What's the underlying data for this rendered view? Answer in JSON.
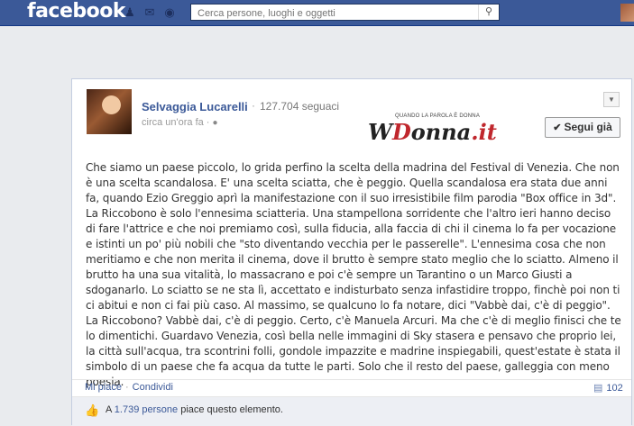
{
  "topbar": {
    "logo": "facebook",
    "search_placeholder": "Cerca persone, luoghi e oggetti",
    "icons": [
      "friend-requests-icon",
      "messages-icon",
      "notifications-icon",
      "search-icon"
    ]
  },
  "post": {
    "author": "Selvaggia Lucarelli",
    "separator": "·",
    "followers": "127.704 seguaci",
    "time": "circa un'ora fa ·",
    "brand_logo": {
      "text_prefix": "W",
      "text_d": "D",
      "text_rest": "onna",
      "text_suffix": ".it",
      "tagline": "QUANDO LA PAROLA È DONNA"
    },
    "follow_button": "Segui già",
    "body": "Che siamo un paese piccolo, lo grida perfino la scelta della madrina del Festival di Venezia. Che non è una scelta scandalosa. E' una scelta sciatta, che è peggio. Quella scandalosa era stata due anni fa, quando Ezio Greggio aprì la manifestazione con il suo irresistibile film parodia \"Box office in 3d\". La Riccobono è solo l'ennesima sciatteria. Una stampellona sorridente che l'altro ieri hanno deciso di fare l'attrice e che noi premiamo così, sulla fiducia, alla faccia di chi il cinema lo fa per vocazione e istinti un po' più nobili che \"sto diventando vecchia per le passerelle\". L'ennesima cosa che non meritiamo e che non merita il cinema, dove il brutto è sempre stato meglio che lo sciatto. Almeno il brutto ha una sua vitalità, lo massacrano e poi c'è sempre un Tarantino o un Marco Giusti a sdoganarlo. Lo sciatto se ne sta lì, accettato e indisturbato senza infastidire troppo, finchè poi non ti ci abitui e non ci fai più caso. Al massimo, se qualcuno lo fa notare, dici \"Vabbè dai, c'è di peggio\". La Riccobono? Vabbè dai, c'è di peggio. Certo, c'è Manuela Arcuri. Ma che c'è di meglio finisci che te lo dimentichi. Guardavo Venezia, così bella nelle immagini di Sky stasera e pensavo che proprio lei, la città sull'acqua, tra scontrini folli, gondole impazzite e madrine inspiegabili, quest'estate è stata il simbolo di un paese che fa acqua da tutte le parti. Solo che il resto del paese, galleggia con meno poesia.",
    "actions": {
      "like": "Mi piace",
      "sep": "·",
      "share": "Condividi"
    },
    "comment_count": "102",
    "likes": {
      "prefix": "A",
      "count_link": "1.739 persone",
      "suffix": "piace questo elemento."
    }
  }
}
